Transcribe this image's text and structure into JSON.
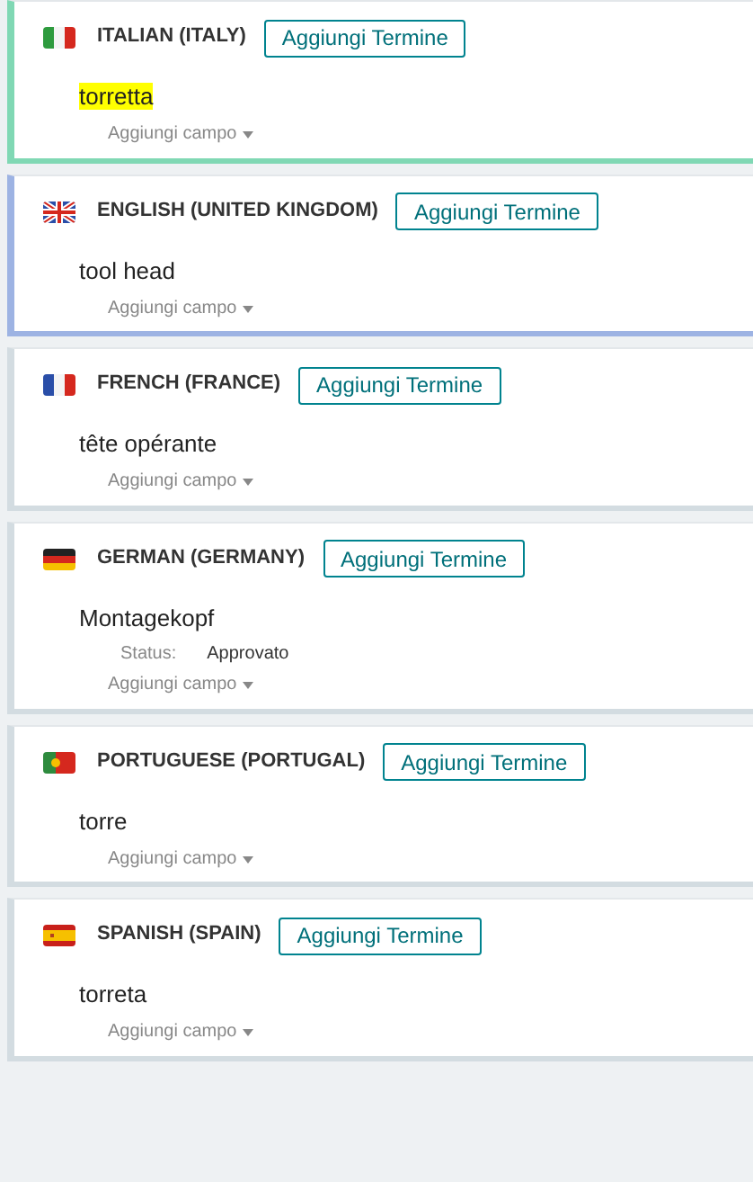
{
  "cards": [
    {
      "kind": "it",
      "language": "ITALIAN (ITALY)",
      "color": "#80d8b4",
      "button": "Aggiungi Termine",
      "term": "torretta",
      "highlighted": true,
      "add_field": "Aggiungi campo"
    },
    {
      "kind": "gb",
      "language": "ENGLISH (UNITED KINGDOM)",
      "color": "#9db3e3",
      "button": "Aggiungi Termine",
      "term": "tool head",
      "highlighted": false,
      "add_field": "Aggiungi campo"
    },
    {
      "kind": "fr",
      "language": "FRENCH (FRANCE)",
      "color": "#d3dce1",
      "button": "Aggiungi Termine",
      "term": "tête opérante",
      "highlighted": false,
      "add_field": "Aggiungi campo"
    },
    {
      "kind": "de",
      "language": "GERMAN (GERMANY)",
      "color": "#d3dce1",
      "button": "Aggiungi Termine",
      "term": "Montagekopf",
      "highlighted": false,
      "fields": [
        {
          "label": "Status:",
          "value": "Approvato"
        }
      ],
      "add_field": "Aggiungi campo"
    },
    {
      "kind": "pt",
      "language": "PORTUGUESE (PORTUGAL)",
      "color": "#d3dce1",
      "button": "Aggiungi Termine",
      "term": "torre",
      "highlighted": false,
      "add_field": "Aggiungi campo"
    },
    {
      "kind": "es",
      "language": "SPANISH (SPAIN)",
      "color": "#d3dce1",
      "button": "Aggiungi Termine",
      "term": "torreta",
      "highlighted": false,
      "add_field": "Aggiungi campo"
    }
  ]
}
